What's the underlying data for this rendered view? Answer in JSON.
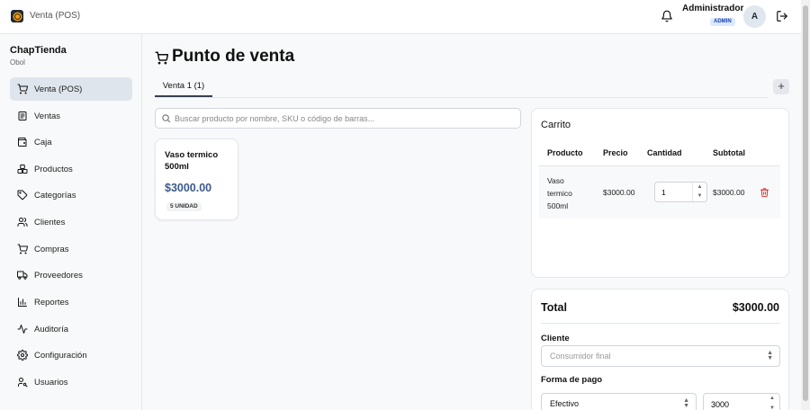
{
  "app": {
    "title": "Venta (POS)"
  },
  "user": {
    "name": "Administrador",
    "role": "ADMIN",
    "initial": "A"
  },
  "sidebar": {
    "brand": "ChapTienda",
    "subtitle": "Obol",
    "items": [
      {
        "label": "Venta (POS)",
        "icon": "cart-icon",
        "active": true
      },
      {
        "label": "Ventas",
        "icon": "receipt-icon"
      },
      {
        "label": "Caja",
        "icon": "wallet-icon"
      },
      {
        "label": "Productos",
        "icon": "boxes-icon"
      },
      {
        "label": "Categorías",
        "icon": "tag-icon"
      },
      {
        "label": "Clientes",
        "icon": "users-icon"
      },
      {
        "label": "Compras",
        "icon": "cart-icon"
      },
      {
        "label": "Proveedores",
        "icon": "truck-icon"
      },
      {
        "label": "Reportes",
        "icon": "chart-icon"
      },
      {
        "label": "Auditoría",
        "icon": "activity-icon"
      },
      {
        "label": "Configuración",
        "icon": "gear-icon"
      },
      {
        "label": "Usuarios",
        "icon": "user-key-icon"
      }
    ]
  },
  "main": {
    "title": "Punto de venta",
    "tabs": [
      {
        "label": "Venta 1 (1)"
      }
    ],
    "add_tab": "+",
    "search": {
      "placeholder": "Buscar producto por nombre, SKU o código de barras...",
      "value": ""
    }
  },
  "products": [
    {
      "name": "Vaso termico 500ml",
      "price": "$3000.00",
      "stock": "5 UNIDAD"
    }
  ],
  "cart": {
    "title": "Carrito",
    "columns": [
      "Producto",
      "Precio",
      "Cantidad",
      "Subtotal"
    ],
    "rows": [
      {
        "product": "Vaso termico 500ml",
        "price": "$3000.00",
        "quantity": "1",
        "subtotal": "$3000.00"
      }
    ]
  },
  "summary": {
    "total_label": "Total",
    "total_value": "$3000.00",
    "client_label": "Cliente",
    "client_placeholder": "Consumidor final",
    "payment_label": "Forma de pago",
    "payment_method": "Efectivo",
    "amount": "3000"
  },
  "colors": {
    "price": "#3b5b8a",
    "active_nav": "#dfe5ec",
    "badge_bg": "#dbeafe",
    "delete": "#dc2626"
  }
}
